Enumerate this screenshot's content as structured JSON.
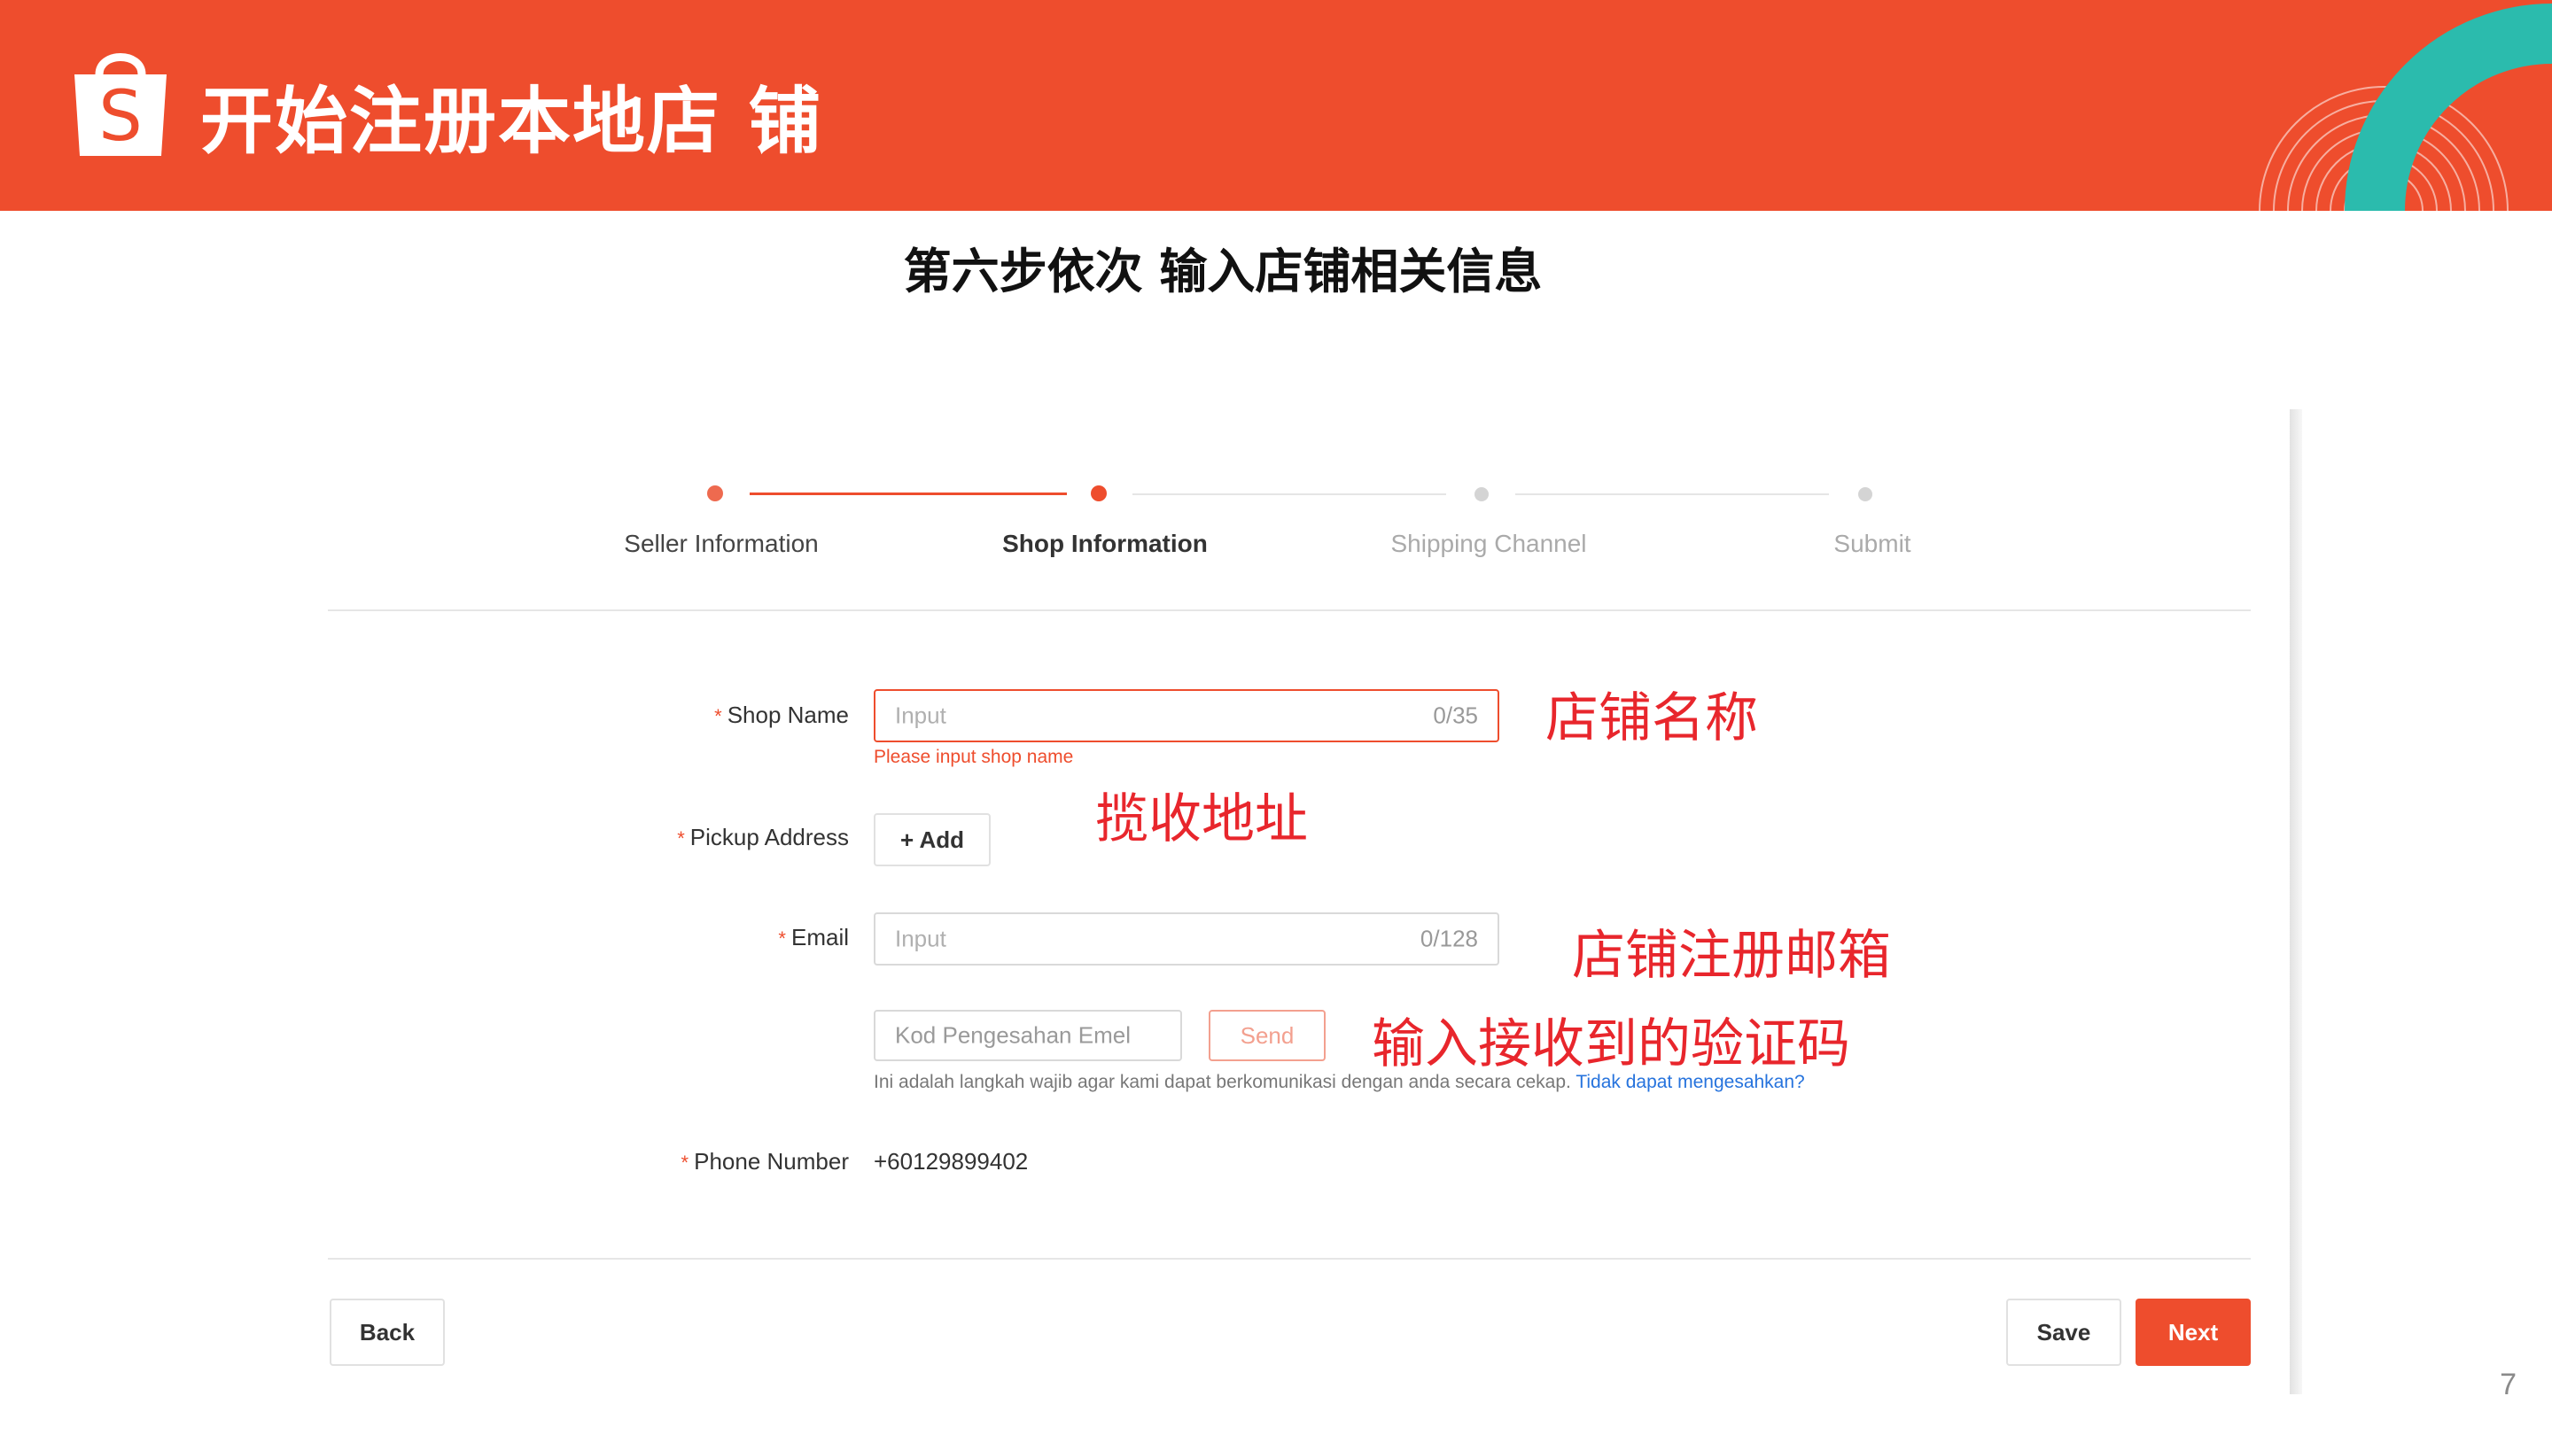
{
  "header": {
    "title": "开始注册本地店 铺",
    "brand_color": "#EE4D2D",
    "logo_letter": "S"
  },
  "subtitle": "第六步依次 输入店铺相关信息",
  "stepper": {
    "steps": [
      {
        "label": "Seller Information",
        "state": "done"
      },
      {
        "label": "Shop Information",
        "state": "active"
      },
      {
        "label": "Shipping Channel",
        "state": "pending"
      },
      {
        "label": "Submit",
        "state": "pending"
      }
    ]
  },
  "form": {
    "shop_name": {
      "label": "Shop Name",
      "placeholder": "Input",
      "counter": "0/35",
      "error": "Please input shop name"
    },
    "pickup_address": {
      "label": "Pickup Address",
      "add_button": "+ Add"
    },
    "email": {
      "label": "Email",
      "placeholder": "Input",
      "counter": "0/128"
    },
    "verification": {
      "placeholder": "Kod Pengesahan Emel",
      "send_button": "Send",
      "note": "Ini adalah langkah wajib agar kami dapat berkomunikasi dengan anda secara cekap.",
      "note_link": "Tidak dapat mengesahkan?"
    },
    "phone": {
      "label": "Phone Number",
      "value": "+60129899402"
    },
    "required_mark": "*"
  },
  "footer": {
    "back": "Back",
    "save": "Save",
    "next": "Next"
  },
  "annotations": {
    "shop_name": "店铺名称",
    "pickup": "揽收地址",
    "email": "店铺注册邮箱",
    "code": "输入接收到的验证码"
  },
  "page_number": "7"
}
